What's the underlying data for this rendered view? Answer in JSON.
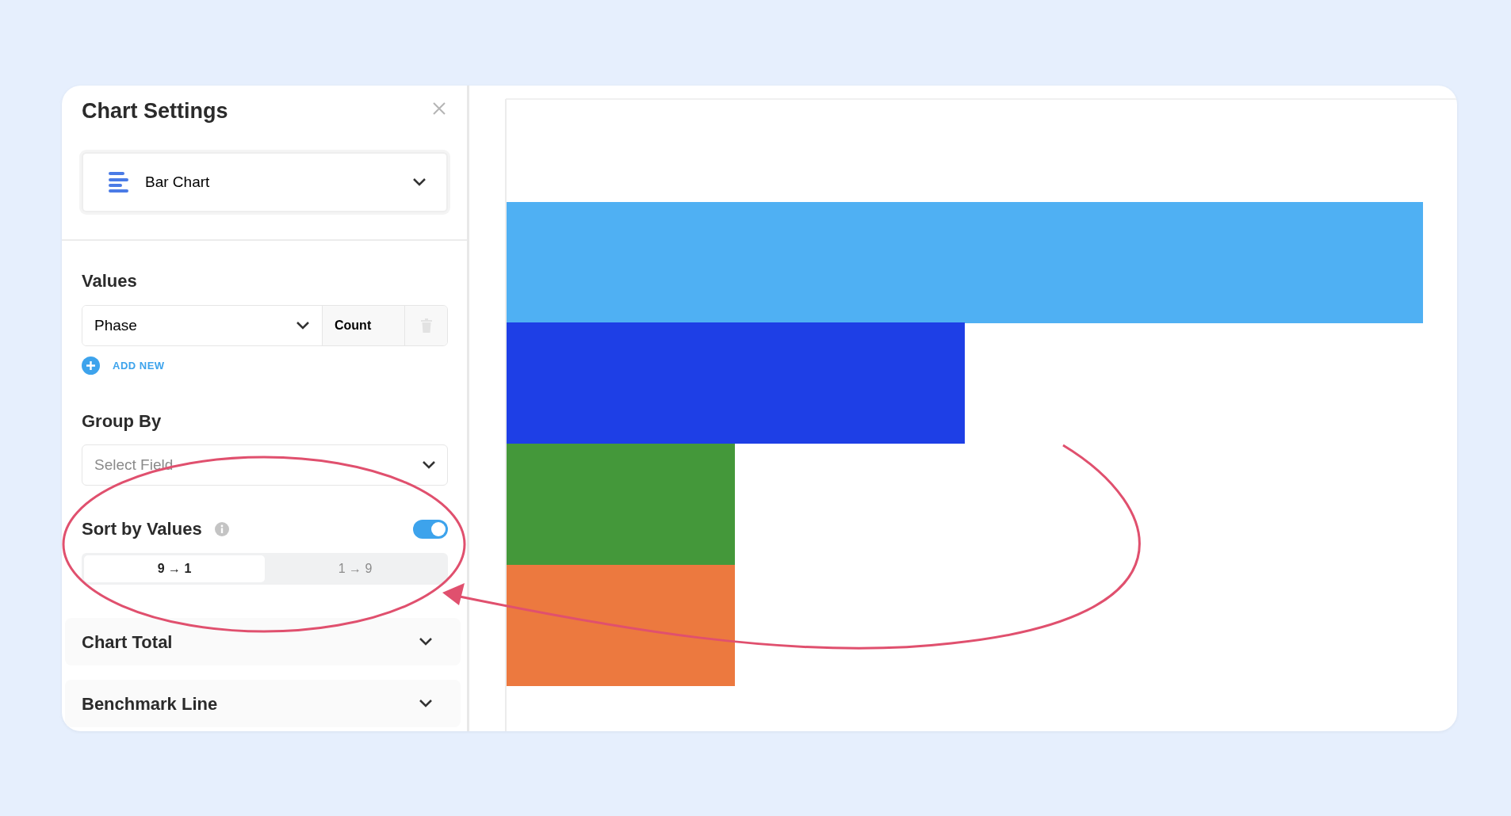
{
  "panel": {
    "title": "Chart Settings"
  },
  "chart_type": {
    "label": "Bar Chart"
  },
  "values": {
    "title": "Values",
    "rows": [
      {
        "field": "Phase",
        "aggregate": "Count"
      }
    ],
    "add_new": "ADD NEW"
  },
  "group_by": {
    "title": "Group By",
    "placeholder": "Select Field"
  },
  "sort": {
    "label": "Sort by Values",
    "on": true,
    "options": [
      {
        "label": "9 → 1",
        "selected": true
      },
      {
        "label": "1 → 9",
        "selected": false
      }
    ]
  },
  "sections": [
    {
      "title": "Chart Total",
      "expanded": false
    },
    {
      "title": "Benchmark Line",
      "expanded": false
    }
  ]
}
